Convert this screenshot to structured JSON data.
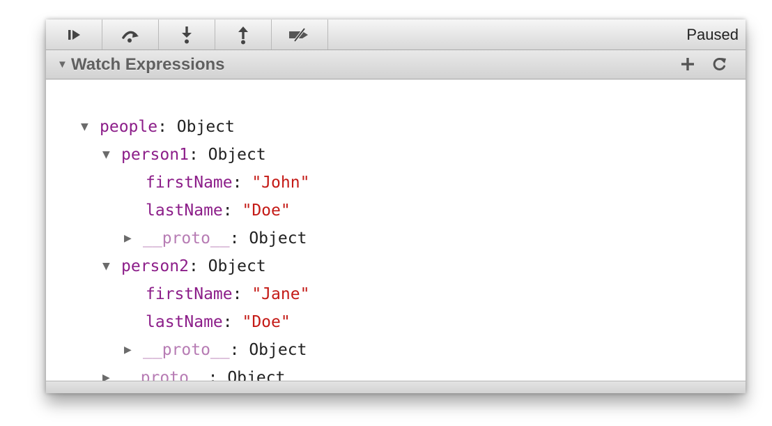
{
  "toolbar": {
    "buttons": [
      {
        "name": "resume",
        "icon": "resume-icon"
      },
      {
        "name": "step-over",
        "icon": "step-over-icon"
      },
      {
        "name": "step-into",
        "icon": "step-into-icon"
      },
      {
        "name": "step-out",
        "icon": "step-out-icon"
      },
      {
        "name": "deactivate-breakpoints",
        "icon": "deactivate-breakpoints-icon"
      }
    ],
    "status": "Paused"
  },
  "watch": {
    "title": "Watch Expressions",
    "expand_glyph": "▼",
    "add_glyph": "+",
    "refresh_glyph": "C"
  },
  "tree": {
    "expanded_glyph": "▼",
    "collapsed_glyph": "▶",
    "people_key": "people",
    "people_type": "Object",
    "person1_key": "person1",
    "person1_type": "Object",
    "person1_first_key": "firstName",
    "person1_first_value": "\"John\"",
    "person1_last_key": "lastName",
    "person1_last_value": "\"Doe\"",
    "person1_proto_key": "__proto__",
    "person1_proto_type": "Object",
    "person2_key": "person2",
    "person2_type": "Object",
    "person2_first_key": "firstName",
    "person2_first_value": "\"Jane\"",
    "person2_last_key": "lastName",
    "person2_last_value": "\"Doe\"",
    "person2_proto_key": "__proto__",
    "person2_proto_type": "Object",
    "people_proto_key": "__proto__",
    "people_proto_type": "Object",
    "separator": ": "
  },
  "colors": {
    "property_name": "#8c1e89",
    "proto_name": "#b77cb4",
    "string_value": "#c41a16"
  }
}
